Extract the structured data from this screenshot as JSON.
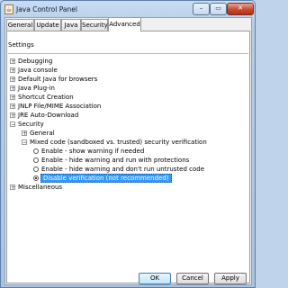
{
  "window": {
    "title": "Java Control Panel"
  },
  "tabs": [
    {
      "label": "General"
    },
    {
      "label": "Update"
    },
    {
      "label": "Java"
    },
    {
      "label": "Security"
    },
    {
      "label": "Advanced",
      "active": true
    }
  ],
  "settings_label": "Settings",
  "tree": {
    "top_items": [
      {
        "label": "Debugging",
        "toggle": "+"
      },
      {
        "label": "Java console",
        "toggle": "+"
      },
      {
        "label": "Default Java for browsers",
        "toggle": "+"
      },
      {
        "label": "Java Plug-in",
        "toggle": "+"
      },
      {
        "label": "Shortcut Creation",
        "toggle": "+"
      },
      {
        "label": "JNLP File/MIME Association",
        "toggle": "+"
      },
      {
        "label": "JRE Auto-Download",
        "toggle": "+"
      },
      {
        "label": "Security",
        "toggle": "−"
      }
    ],
    "security_children": [
      {
        "label": "General",
        "toggle": "+"
      },
      {
        "label": "Mixed code (sandboxed vs. trusted) security verification",
        "toggle": "−"
      }
    ],
    "mixed_code_options": [
      {
        "label": "Enable - show warning if needed",
        "checked": false
      },
      {
        "label": "Enable - hide warning and run with protections",
        "checked": false
      },
      {
        "label": "Enable - hide warning and don't run untrusted code",
        "checked": false
      },
      {
        "label": "Disable verification (not recommended)",
        "checked": true
      }
    ],
    "miscellaneous": {
      "label": "Miscellaneous",
      "toggle": "+"
    }
  },
  "buttons": {
    "ok": "OK",
    "cancel": "Cancel",
    "apply": "Apply"
  },
  "colors": {
    "selection": "#3399ff",
    "close_button": "#c94a30"
  }
}
